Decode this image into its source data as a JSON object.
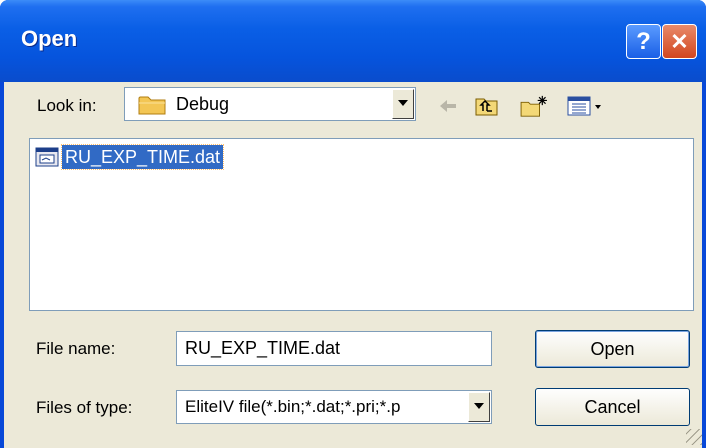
{
  "window": {
    "title": "Open",
    "help_glyph": "?",
    "close_glyph": "✕"
  },
  "lookin": {
    "label": "Look in:",
    "folder": "Debug",
    "folder_icon": "folder-icon"
  },
  "toolbar": {
    "back_icon": "back-arrow-icon",
    "up_icon": "up-one-level-icon",
    "new_folder_icon": "new-folder-icon",
    "view_menu_icon": "view-menu-icon"
  },
  "files": [
    {
      "name": "RU_EXP_TIME.dat",
      "icon": "dat-file-icon",
      "selected": true
    }
  ],
  "filename": {
    "label": "File name:",
    "value": "RU_EXP_TIME.dat"
  },
  "filetype": {
    "label": "Files of type:",
    "value": "EliteIV file(*.bin;*.dat;*.pri;*.p"
  },
  "buttons": {
    "open": "Open",
    "cancel": "Cancel"
  },
  "colors": {
    "titlebar": "#0a5fe6",
    "dialog_bg": "#ece9d8",
    "selection": "#316ac5"
  }
}
